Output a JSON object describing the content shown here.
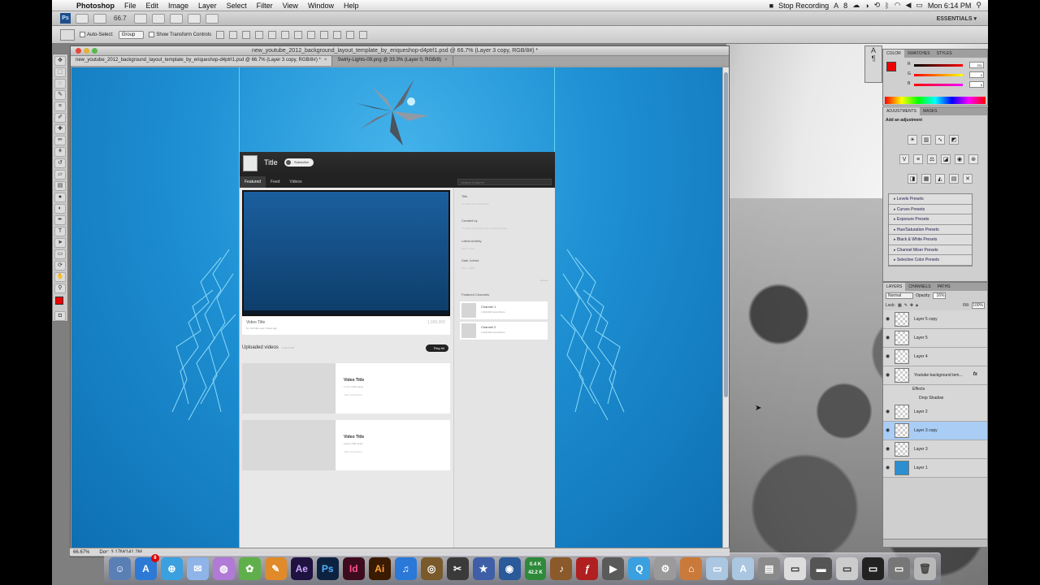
{
  "menubar": {
    "app": "Photoshop",
    "items": [
      "File",
      "Edit",
      "Image",
      "Layer",
      "Select",
      "Filter",
      "View",
      "Window",
      "Help"
    ],
    "status_recording": "Stop Recording",
    "count": "8",
    "clock": "Mon 6:14 PM"
  },
  "appbar": {
    "zoom": "66.7",
    "workspace": "ESSENTIALS ▾"
  },
  "options": {
    "auto_select": "Auto-Select:",
    "group": "Group",
    "transform": "Show Transform Controls"
  },
  "document": {
    "window_title": "new_youtube_2012_background_layout_template_by_eriqueshop-d4ptrl1.psd @ 66.7% (Layer 3 copy, RGB/8#) *",
    "tabs": [
      "new_youtube_2012_background_layout_template_by_eriqueshop-d4ptrl1.psd @ 66.7% (Layer 3 copy, RGB/8#) *",
      "Swirly-Lights-09.png @ 33.3% (Layer 0, RGB/8)"
    ],
    "status_zoom": "66.67%",
    "status_doc": "Doc: 3.17M/141.2M"
  },
  "youtube": {
    "title": "Title",
    "subscribe": "Subscribe",
    "tabs": [
      "Featured",
      "Feed",
      "Videos"
    ],
    "search_placeholder": "Search Channel",
    "video_title": "Video Title",
    "video_meta": "by YouTube user 3 days ago",
    "video_views": "1,000,000",
    "uploaded": "Uploaded videos",
    "uploaded_count": "1-10 of 100",
    "play_all": "Play All",
    "cards": [
      {
        "title": "Video Title",
        "meta": "1 min  1,000 views",
        "desc": "Video description"
      },
      {
        "title": "Video Title",
        "meta": "Feed  1,000 views",
        "desc": "Video description"
      }
    ],
    "side": {
      "title": "Title",
      "desc": "YouTube user description",
      "created_by": "Created by",
      "created_val": "YouTube user   Block User | Send Message",
      "latest": "Latest Activity",
      "latest_val": "Dec 5, 2011",
      "joined": "Date Joined",
      "joined_val": "Feb 1, 2008",
      "more": "more ▸",
      "featured": "Featured Channels",
      "channels": [
        {
          "name": "Channel 1",
          "subs": "1,000,000 subscribers"
        },
        {
          "name": "Channel 2",
          "subs": "1,000,000 subscribers"
        }
      ]
    }
  },
  "panels": {
    "color_tabs": [
      "COLOR",
      "SWATCHES",
      "STYLES"
    ],
    "color_rows": [
      {
        "label": "R",
        "value": "251"
      },
      {
        "label": "G",
        "value": "0"
      },
      {
        "label": "B",
        "value": "6"
      }
    ],
    "adj_tabs": [
      "ADJUSTMENTS",
      "MASKS"
    ],
    "adj_header": "Add an adjustment",
    "presets": [
      "Levels Presets",
      "Curves Presets",
      "Exposure Presets",
      "Hue/Saturation Presets",
      "Black & White Presets",
      "Channel Mixer Presets",
      "Selective Color Presets"
    ],
    "layers_tabs": [
      "LAYERS",
      "CHANNELS",
      "PATHS"
    ],
    "blend_mode": "Normal",
    "opacity_label": "Opacity:",
    "opacity": "16%",
    "lock_label": "Lock:",
    "fill_label": "Fill:",
    "fill": "100%",
    "layers": [
      "Layer 5 copy",
      "Layer 5",
      "Layer 4",
      "Youtube background tem...",
      "Layer 2",
      "Layer 3 copy",
      "Layer 3",
      "Layer 1"
    ],
    "effects": "Effects",
    "drop_shadow": "Drop Shadow",
    "fx": "fx"
  },
  "dock": {
    "apps": [
      "Ae",
      "Ps",
      "Id",
      "Ai"
    ],
    "mail_badge": "8",
    "net_up": "0.4 K",
    "net_down": "42.2 K"
  }
}
